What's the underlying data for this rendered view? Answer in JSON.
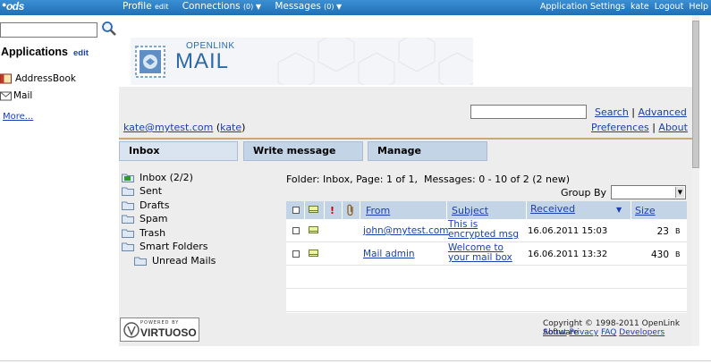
{
  "topbar": {
    "logo": "ods",
    "profile": "Profile",
    "profile_edit": "edit",
    "connections": "Connections",
    "connections_count": "(0) ▼",
    "messages": "Messages",
    "messages_count": "(0) ▼",
    "app_settings": "Application Settings",
    "user": "kate",
    "logout": "Logout",
    "help": "Help"
  },
  "sidebar": {
    "search_value": "",
    "apps_title": "Applications",
    "apps_edit": "edit",
    "items": [
      {
        "label": "AddressBook",
        "icon": "address-book-icon"
      },
      {
        "label": "Mail",
        "icon": "mail-icon"
      }
    ],
    "more": "More..."
  },
  "banner": {
    "logo_line1": "OPENLINK",
    "logo_line2": "MAIL"
  },
  "header": {
    "search_value": "",
    "search_link": "Search",
    "sep1": "|",
    "advanced_link": "Advanced",
    "user_email": "kate@mytest.com",
    "user_name": "kate",
    "preferences_link": "Preferences",
    "sep2": "|",
    "about_link": "About"
  },
  "tabs": [
    "Inbox",
    "Write message",
    "Manage"
  ],
  "folders": [
    {
      "label": "Inbox",
      "count": "(2/2)",
      "bold": true
    },
    {
      "label": "Sent"
    },
    {
      "label": "Drafts"
    },
    {
      "label": "Spam"
    },
    {
      "label": "Trash"
    },
    {
      "label": "Smart Folders"
    },
    {
      "label": "Unread Mails",
      "indent": true
    }
  ],
  "folder_info": {
    "label": "Folder:",
    "text": "Inbox, Page: 1 of 1,",
    "messages_label": "Messages:",
    "messages_text": "0 - 10 of 2 (2 new)"
  },
  "group_by": {
    "label": "Group By",
    "selected": ""
  },
  "table": {
    "headers": {
      "priority": "!",
      "from": "From",
      "subject": "Subject",
      "received": "Received",
      "sort_arrow": "▼",
      "size": "Size"
    },
    "rows": [
      {
        "from": "john@mytest.com",
        "subject_l1": "This is",
        "subject_l2": "encrypted msg",
        "received": "16.06.2011 15:03",
        "size": "23",
        "unit": "B"
      },
      {
        "from": "Mail admin",
        "subject_l1": "Welcome to",
        "subject_l2": "your mail box",
        "received": "16.06.2011 13:32",
        "size": "430",
        "unit": "B"
      }
    ]
  },
  "footer": {
    "powered": "POWERED BY",
    "virtuoso": "VIRTUOSO",
    "copyright": "Copyright © 1998-2011 OpenLink Software",
    "links": [
      "About",
      "Privacy",
      "FAQ",
      "Developers"
    ]
  }
}
